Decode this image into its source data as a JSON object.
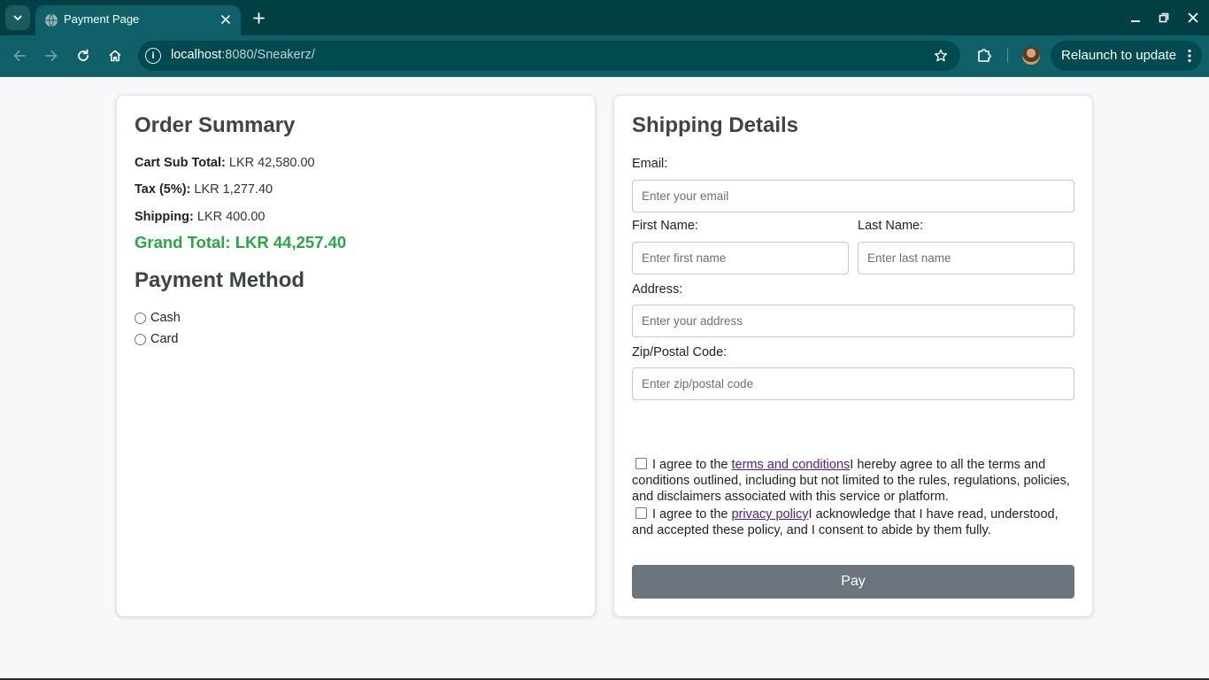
{
  "browser": {
    "tab_title": "Payment Page",
    "url_host": "localhost",
    "url_rest": ":8080/Sneakerz/",
    "relaunch_label": "Relaunch to update",
    "icons": {
      "tab_dropdown": "chevron-down-icon",
      "favicon": "globe-icon",
      "tab_close": "close-icon",
      "new_tab": "plus-icon",
      "minimize": "minimize-icon",
      "restore": "restore-icon",
      "close_window": "close-icon",
      "back": "arrow-left-icon",
      "forward": "arrow-right-icon",
      "reload": "reload-icon",
      "home": "home-icon",
      "site_info": "info-icon",
      "bookmark": "star-icon",
      "extensions": "puzzle-icon",
      "menu": "kebab-menu-icon"
    },
    "colors": {
      "tabbar": "#003f44",
      "toolbar": "#0f6068"
    }
  },
  "order_summary": {
    "title": "Order Summary",
    "subtotal_label": "Cart Sub Total:",
    "subtotal_value": "LKR 42,580.00",
    "tax_label": "Tax (5%):",
    "tax_value": "LKR 1,277.40",
    "shipping_label": "Shipping:",
    "shipping_value": "LKR 400.00",
    "grand_total": "Grand Total: LKR 44,257.40",
    "grand_total_color": "#28a745"
  },
  "payment_method": {
    "title": "Payment Method",
    "options": [
      "Cash",
      "Card"
    ]
  },
  "shipping": {
    "title": "Shipping Details",
    "email_label": "Email:",
    "email_placeholder": "Enter your email",
    "first_name_label": "First Name:",
    "first_name_placeholder": "Enter first name",
    "last_name_label": "Last Name:",
    "last_name_placeholder": "Enter last name",
    "address_label": "Address:",
    "address_placeholder": "Enter your address",
    "zip_label": "Zip/Postal Code:",
    "zip_placeholder": "Enter zip/postal code"
  },
  "agreements": {
    "terms_prefix": "I agree to the ",
    "terms_link": "terms and conditions",
    "terms_suffix": "I hereby agree to all the terms and conditions outlined, including but not limited to the rules, regulations, policies, and disclaimers associated with this service or platform.",
    "privacy_prefix": "I agree to the ",
    "privacy_link": "privacy policy",
    "privacy_suffix": "I acknowledge that I have read, understood, and accepted these policy, and I consent to abide by them fully."
  },
  "pay_button": {
    "label": "Pay",
    "color": "#6c757d"
  }
}
